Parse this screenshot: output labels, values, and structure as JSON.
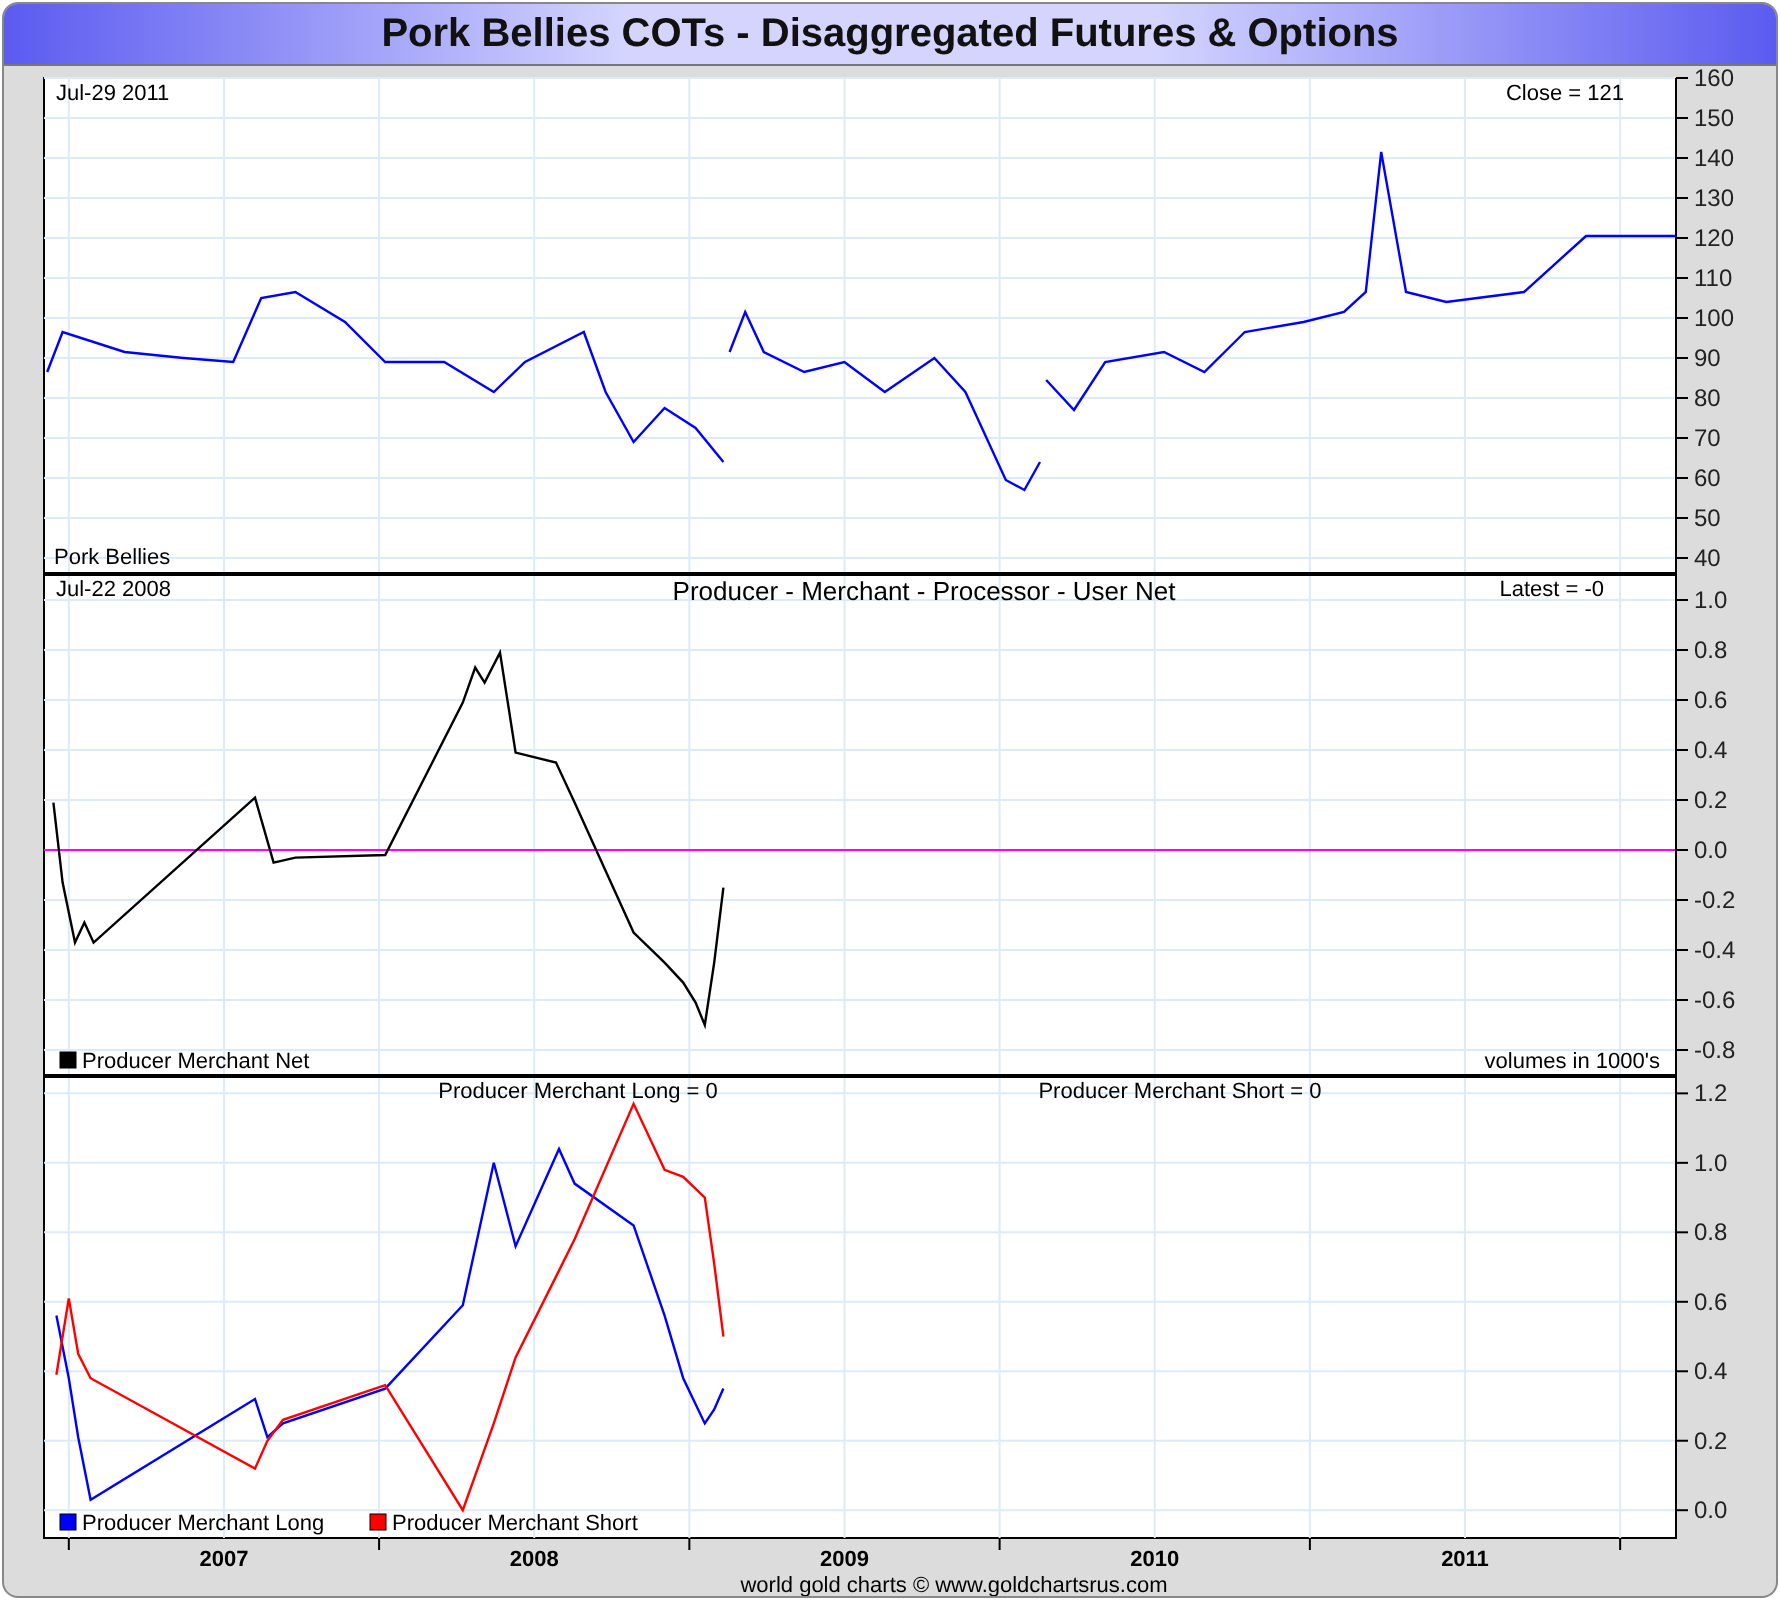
{
  "title": "Pork Bellies COTs - Disaggregated Futures & Options",
  "panels": [
    {
      "kind": "price",
      "date": "Jul-29  2011",
      "reading": "Close = 121",
      "chart_data": {
        "type": "line",
        "grid": true,
        "xlim": [
          2006.92,
          2012.18
        ],
        "ylim": [
          36,
          160
        ],
        "yticks": [
          {
            "value": 40,
            "label": "40"
          },
          {
            "value": 50,
            "label": "50"
          },
          {
            "value": 60,
            "label": "60"
          },
          {
            "value": 70,
            "label": "70"
          },
          {
            "value": 80,
            "label": "80"
          },
          {
            "value": 90,
            "label": "90"
          },
          {
            "value": 100,
            "label": "100"
          },
          {
            "value": 110,
            "label": "110"
          },
          {
            "value": 120,
            "label": "120"
          },
          {
            "value": 130,
            "label": "130"
          },
          {
            "value": 140,
            "label": "140"
          },
          {
            "value": 150,
            "label": "150"
          },
          {
            "value": 160,
            "label": "160"
          }
        ],
        "x": [
          2006.93,
          2006.98,
          2007.18,
          2007.37,
          2007.53,
          2007.62,
          2007.73,
          2007.89,
          2008.02,
          2008.21,
          2008.37,
          2008.47,
          2008.66,
          2008.73,
          2008.82,
          2008.92,
          2009.02,
          2009.11,
          2009.12,
          2009.13,
          2009.18,
          2009.24,
          2009.37,
          2009.5,
          2009.63,
          2009.79,
          2009.89,
          2010.02,
          2010.08,
          2010.13,
          2010.14,
          2010.15,
          2010.24,
          2010.34,
          2010.53,
          2010.66,
          2010.79,
          2010.98,
          2011.11,
          2011.18,
          2011.23,
          2011.31,
          2011.44,
          2011.69,
          2011.89,
          2012.18
        ],
        "series": [
          {
            "name": "Pork Bellies",
            "color": "#0000ff",
            "values": [
              86.5,
              96.5,
              91.5,
              90,
              89,
              105,
              106.5,
              99,
              89,
              89,
              81.5,
              89,
              96.5,
              81.5,
              69,
              77.5,
              72.5,
              64,
              null,
              91.5,
              101.5,
              91.5,
              86.5,
              89,
              81.5,
              90,
              81.5,
              59.5,
              57,
              64,
              null,
              84.5,
              77,
              89,
              91.5,
              86.5,
              96.5,
              99,
              101.5,
              106.5,
              141.5,
              106.5,
              104,
              106.5,
              120.5,
              120.5
            ]
          }
        ]
      }
    },
    {
      "kind": "net",
      "date": "Jul-22  2008",
      "heading": "Producer - Merchant - Processor - User Net",
      "reading": "Latest = -0",
      "note": "volumes in 1000's",
      "chart_data": {
        "type": "line",
        "grid": true,
        "legend": true,
        "xlim": [
          2006.92,
          2012.18
        ],
        "ylim": [
          -0.9,
          1.1
        ],
        "yticks": [
          {
            "value": -0.8,
            "label": "-0.8"
          },
          {
            "value": -0.6,
            "label": "-0.6"
          },
          {
            "value": -0.4,
            "label": "-0.4"
          },
          {
            "value": -0.2,
            "label": "-0.2"
          },
          {
            "value": 0,
            "label": "0.0"
          },
          {
            "value": 0.2,
            "label": "0.2"
          },
          {
            "value": 0.4,
            "label": "0.4"
          },
          {
            "value": 0.6,
            "label": "0.6"
          },
          {
            "value": 0.8,
            "label": "0.8"
          },
          {
            "value": 1.0,
            "label": "1.0"
          }
        ],
        "ref_lines": [
          {
            "axis": "y",
            "value": 0,
            "color": "#ff00ff"
          }
        ],
        "x": [
          2006.95,
          2006.98,
          2007.02,
          2007.05,
          2007.08,
          2007.6,
          2007.66,
          2007.73,
          2008.02,
          2008.27,
          2008.31,
          2008.34,
          2008.39,
          2008.44,
          2008.57,
          2008.63,
          2008.82,
          2008.92,
          2008.98,
          2009.02,
          2009.05,
          2009.08,
          2009.11
        ],
        "series": [
          {
            "name": "Producer Merchant Net",
            "color": "#000000",
            "values": [
              0.19,
              -0.13,
              -0.37,
              -0.29,
              -0.37,
              0.21,
              -0.05,
              -0.03,
              -0.02,
              0.59,
              0.73,
              0.67,
              0.79,
              0.39,
              0.35,
              0.19,
              -0.33,
              -0.45,
              -0.53,
              -0.61,
              -0.7,
              -0.45,
              -0.15
            ]
          }
        ]
      }
    },
    {
      "kind": "long_short",
      "readings": [
        "Producer Merchant Long = 0",
        "Producer Merchant Short = 0"
      ],
      "chart_data": {
        "type": "line",
        "grid": true,
        "legend": true,
        "xlim": [
          2006.92,
          2012.18
        ],
        "ylim": [
          -0.08,
          1.25
        ],
        "yticks": [
          {
            "value": 0,
            "label": "0.0"
          },
          {
            "value": 0.2,
            "label": "0.2"
          },
          {
            "value": 0.4,
            "label": "0.4"
          },
          {
            "value": 0.6,
            "label": "0.6"
          },
          {
            "value": 0.8,
            "label": "0.8"
          },
          {
            "value": 1.0,
            "label": "1.0"
          },
          {
            "value": 1.2,
            "label": "1.2"
          }
        ],
        "xticks": [
          {
            "value": 2007.5,
            "label": "2007"
          },
          {
            "value": 2008.5,
            "label": "2008"
          },
          {
            "value": 2009.5,
            "label": "2009"
          },
          {
            "value": 2010.5,
            "label": "2010"
          },
          {
            "value": 2011.5,
            "label": "2011"
          }
        ],
        "x": [
          2006.96,
          2007.0,
          2007.03,
          2007.07,
          2007.6,
          2007.64,
          2007.69,
          2008.02,
          2008.27,
          2008.37,
          2008.44,
          2008.58,
          2008.63,
          2008.82,
          2008.92,
          2008.98,
          2009.05,
          2009.08,
          2009.11
        ],
        "series": [
          {
            "name": "Producer Merchant Long",
            "color": "#0000ff",
            "values": [
              0.56,
              0.38,
              0.21,
              0.03,
              0.32,
              0.21,
              0.25,
              0.35,
              0.59,
              1.0,
              0.76,
              1.04,
              0.94,
              0.82,
              0.56,
              0.38,
              0.25,
              0.29,
              0.35
            ]
          },
          {
            "name": "Producer Merchant Short",
            "color": "#ff0000",
            "values": [
              0.39,
              0.61,
              0.45,
              0.38,
              0.12,
              0.2,
              0.26,
              0.36,
              0.0,
              0.25,
              0.44,
              0.69,
              0.78,
              1.17,
              0.98,
              0.96,
              0.9,
              0.71,
              0.5
            ]
          }
        ]
      }
    }
  ],
  "footer": "world gold charts © www.goldchartsrus.com"
}
